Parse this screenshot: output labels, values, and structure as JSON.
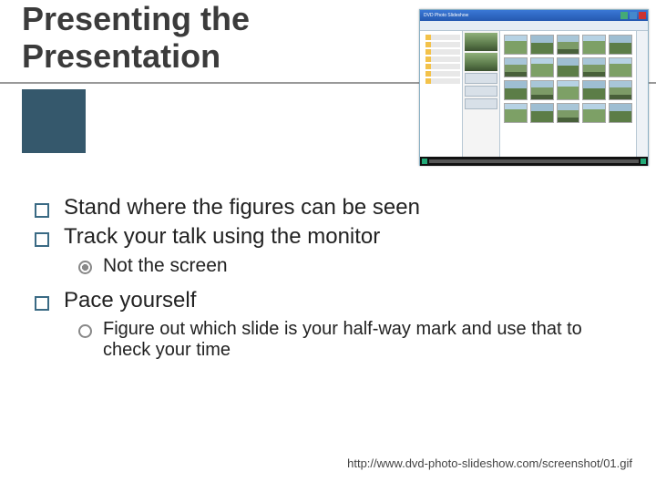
{
  "title": "Presenting the Presentation",
  "bullets": {
    "b1": "Stand where the figures can be seen",
    "b2": "Track your talk using the monitor",
    "b2_sub": "Not the screen",
    "b3": "Pace yourself",
    "b3_sub": "Figure out which slide is your half-way mark and use that to check your time"
  },
  "screenshot": {
    "window_title": "DVD Photo Slideshow"
  },
  "citation": "http://www.dvd-photo-slideshow.com/screenshot/01.gif"
}
